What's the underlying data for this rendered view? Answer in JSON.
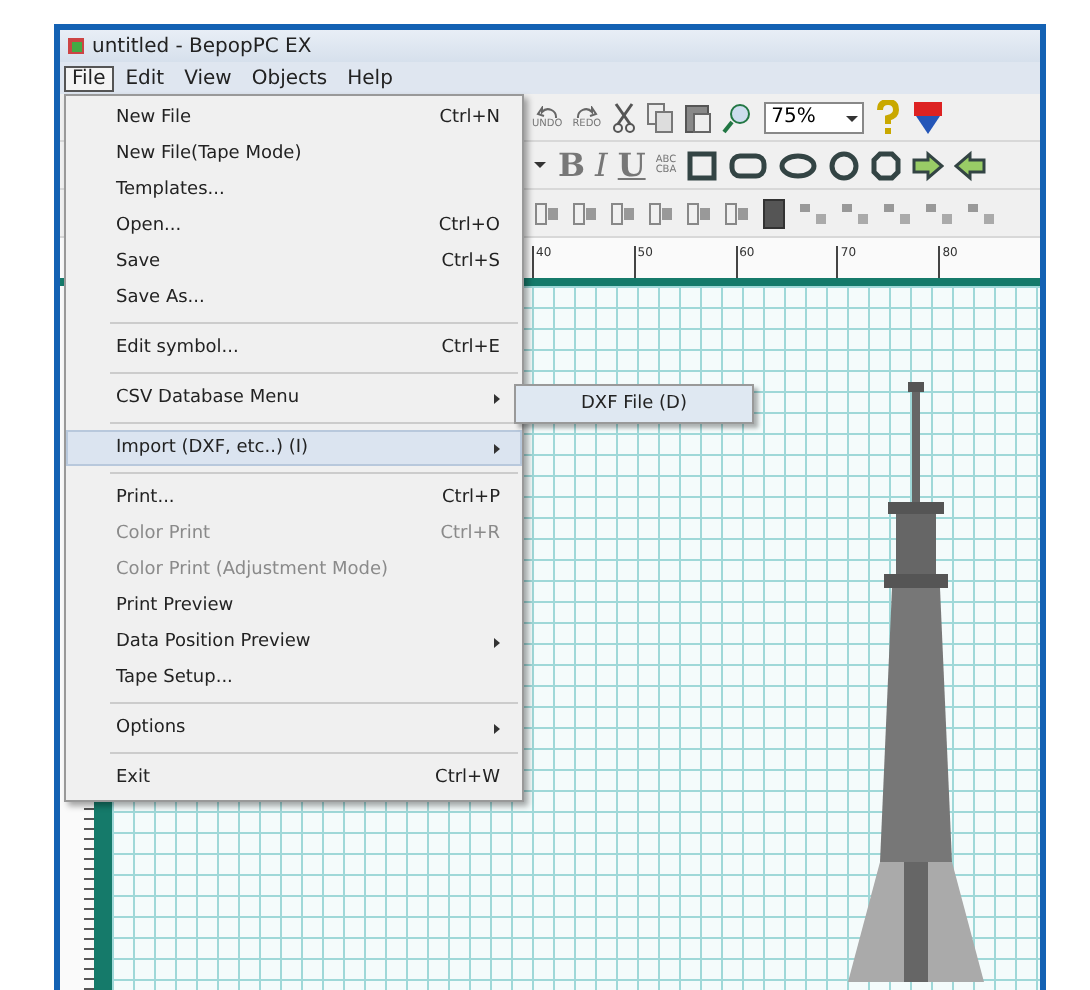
{
  "window": {
    "title": "untitled - BepopPC EX"
  },
  "menu_bar": [
    {
      "label": "File",
      "selected": true
    },
    {
      "label": "Edit",
      "selected": false
    },
    {
      "label": "View",
      "selected": false
    },
    {
      "label": "Objects",
      "selected": false
    },
    {
      "label": "Help",
      "selected": false
    }
  ],
  "file_menu": [
    {
      "kind": "item",
      "label": "New File",
      "shortcut": "Ctrl+N",
      "disabled": false,
      "submenu": false,
      "selected": false
    },
    {
      "kind": "item",
      "label": "New File(Tape Mode)",
      "disabled": false,
      "submenu": false,
      "selected": false
    },
    {
      "kind": "item",
      "label": "Templates...",
      "disabled": false,
      "submenu": false,
      "selected": false
    },
    {
      "kind": "item",
      "label": "Open...",
      "shortcut": "Ctrl+O",
      "disabled": false,
      "submenu": false,
      "selected": false
    },
    {
      "kind": "item",
      "label": "Save",
      "shortcut": "Ctrl+S",
      "disabled": false,
      "submenu": false,
      "selected": false
    },
    {
      "kind": "item",
      "label": "Save As...",
      "disabled": false,
      "submenu": false,
      "selected": false
    },
    {
      "kind": "separator"
    },
    {
      "kind": "item",
      "label": "Edit symbol...",
      "shortcut": "Ctrl+E",
      "disabled": false,
      "submenu": false,
      "selected": false
    },
    {
      "kind": "separator"
    },
    {
      "kind": "item",
      "label": "CSV Database Menu",
      "disabled": false,
      "submenu": true,
      "selected": false
    },
    {
      "kind": "separator"
    },
    {
      "kind": "item",
      "label": "Import (DXF, etc..) (I)",
      "disabled": false,
      "submenu": true,
      "selected": true
    },
    {
      "kind": "separator"
    },
    {
      "kind": "item",
      "label": "Print...",
      "shortcut": "Ctrl+P",
      "disabled": false,
      "submenu": false,
      "selected": false
    },
    {
      "kind": "item",
      "label": "Color Print",
      "shortcut": "Ctrl+R",
      "disabled": true,
      "submenu": false,
      "selected": false
    },
    {
      "kind": "item",
      "label": "Color Print (Adjustment Mode)",
      "disabled": true,
      "submenu": false,
      "selected": false
    },
    {
      "kind": "item",
      "label": "Print Preview",
      "disabled": false,
      "submenu": false,
      "selected": false
    },
    {
      "kind": "item",
      "label": "Data Position Preview",
      "disabled": false,
      "submenu": true,
      "selected": false
    },
    {
      "kind": "item",
      "label": "Tape Setup...",
      "disabled": false,
      "submenu": false,
      "selected": false
    },
    {
      "kind": "separator"
    },
    {
      "kind": "item",
      "label": "Options",
      "disabled": false,
      "submenu": true,
      "selected": false
    },
    {
      "kind": "separator"
    },
    {
      "kind": "item",
      "label": "Exit",
      "shortcut": "Ctrl+W",
      "disabled": false,
      "submenu": false,
      "selected": false
    }
  ],
  "submenu": [
    {
      "label": "DXF File (D)"
    }
  ],
  "toolbar": {
    "undo_label": "UNDO",
    "redo_label": "REDO",
    "zoom": "75%",
    "bold": "B",
    "italic": "I",
    "underline": "U",
    "reverse_top": "ABC",
    "reverse_bottom": "CBA"
  },
  "ruler": [
    "40",
    "50",
    "60",
    "70",
    "80"
  ]
}
